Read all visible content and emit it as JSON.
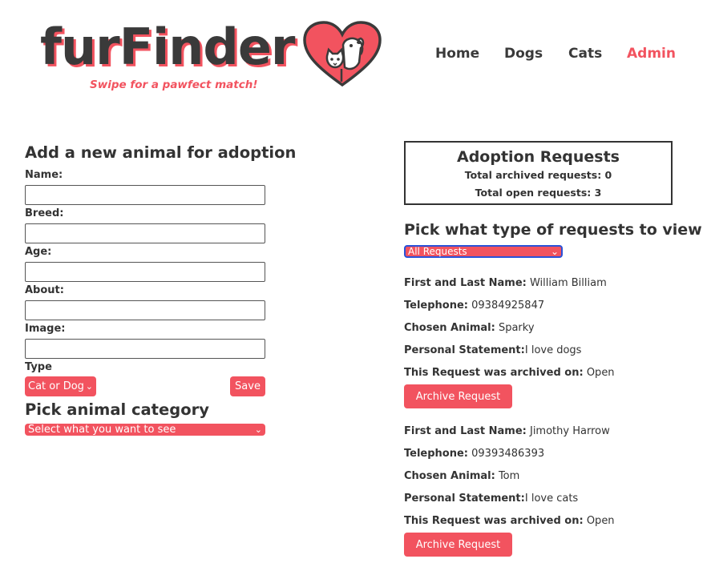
{
  "brand": {
    "name": "furFinder",
    "tagline": "Swipe for a pawfect match!",
    "accent_color": "#f2535f",
    "text_color": "#3a3a3a"
  },
  "nav": {
    "items": [
      {
        "label": "Home",
        "active": false
      },
      {
        "label": "Dogs",
        "active": false
      },
      {
        "label": "Cats",
        "active": false
      },
      {
        "label": "Admin",
        "active": true
      }
    ]
  },
  "add_form": {
    "title": "Add a new animal for adoption",
    "fields": [
      {
        "label": "Name:",
        "value": ""
      },
      {
        "label": "Breed:",
        "value": ""
      },
      {
        "label": "Age:",
        "value": ""
      },
      {
        "label": "About:",
        "value": ""
      },
      {
        "label": "Image:",
        "value": ""
      }
    ],
    "type_label": "Type",
    "type_select": "Cat or Dog",
    "save_label": "Save"
  },
  "category": {
    "title": "Pick animal category",
    "select_value": "Select what you want to see"
  },
  "requests_summary": {
    "title": "Adoption Requests",
    "archived_text": "Total archived requests: 0",
    "open_text": "Total open requests: 3"
  },
  "request_filter": {
    "title": "Pick what type of requests to view",
    "select_value": "All Requests"
  },
  "request_field_labels": {
    "name": "First and Last Name:",
    "telephone": "Telephone:",
    "animal": "Chosen Animal:",
    "statement": "Personal Statement:",
    "archived": "This Request was archived on:"
  },
  "requests": [
    {
      "name": "William Billiam",
      "telephone": "09384925847",
      "animal": "Sparky",
      "statement": "I love dogs",
      "archived": "Open",
      "button_label": "Archive Request"
    },
    {
      "name": "Jimothy Harrow",
      "telephone": "09393486393",
      "animal": "Tom",
      "statement": "I love cats",
      "archived": "Open",
      "button_label": "Archive Request"
    }
  ]
}
